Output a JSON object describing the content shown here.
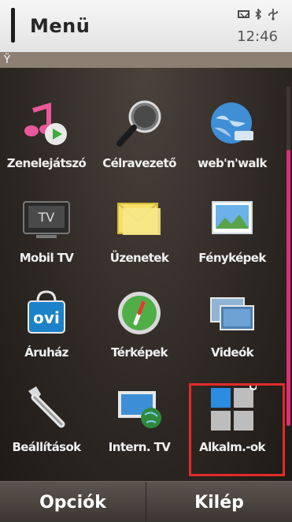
{
  "status_bar": {
    "title": "Menü",
    "time": "12:46",
    "icons": [
      "envelope-icon",
      "bluetooth-icon",
      "usb-icon"
    ]
  },
  "signal_strip": {
    "signal_icon": "antenna-icon"
  },
  "apps": [
    {
      "label": "Zenelejátszó",
      "icon": "music-player-icon"
    },
    {
      "label": "Célravezető",
      "icon": "magnifier-icon"
    },
    {
      "label": "web'n'walk",
      "icon": "globe-icon"
    },
    {
      "label": "Mobil TV",
      "icon": "tv-icon"
    },
    {
      "label": "Üzenetek",
      "icon": "envelope-icon"
    },
    {
      "label": "Fényképek",
      "icon": "photos-icon"
    },
    {
      "label": "Áruház",
      "icon": "ovi-store-icon"
    },
    {
      "label": "Térképek",
      "icon": "compass-icon"
    },
    {
      "label": "Videók",
      "icon": "video-icon"
    },
    {
      "label": "Beállítások",
      "icon": "wrench-icon"
    },
    {
      "label": "Intern. TV",
      "icon": "internet-tv-icon"
    },
    {
      "label": "Alkalm.-ok",
      "icon": "applications-folder-icon"
    }
  ],
  "selected_app": "Alkalm.-ok",
  "softkeys": {
    "left": "Opciók",
    "right": "Kilép"
  },
  "colors": {
    "accent": "#e12d78",
    "selection": "#e22b28"
  }
}
